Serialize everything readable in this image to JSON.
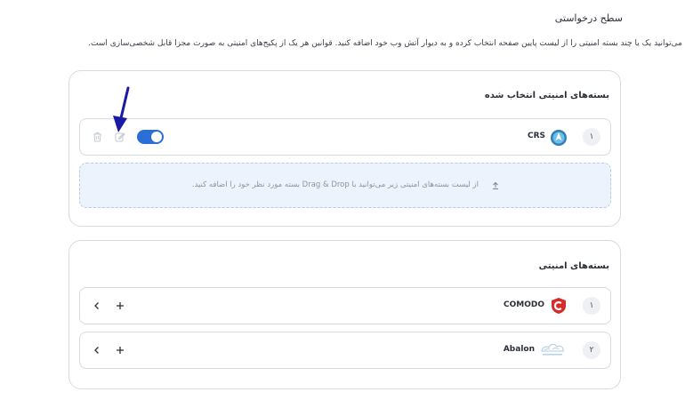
{
  "header": {
    "title": "سطح درخواستی",
    "description": "می‌توانید یک یا چند بسته امنیتی را از لیست پایین صفحه انتخاب کرده و به دیوار آتش وب خود اضافه کنید. قوانین هر یک از پکیج‌های امنیتی به صورت مجزا قابل شخصی‌سازی است."
  },
  "selected": {
    "title": "بسته‌های امنیتی انتخاب شده",
    "items": [
      {
        "index": "۱",
        "name": "CRS",
        "enabled": true
      }
    ],
    "drop_hint": "از لیست بسته‌های امنیتی زیر می‌توانید با Drag & Drop بسته مورد نظر خود را اضافه کنید."
  },
  "available": {
    "title": "بسته‌های امنیتی",
    "items": [
      {
        "index": "۱",
        "name": "COMODO"
      },
      {
        "index": "۲",
        "name": "Abalon"
      }
    ]
  },
  "colors": {
    "accent": "#2b6fd6",
    "border": "#d7dce3",
    "annotation_arrow": "#1a1aa6"
  }
}
